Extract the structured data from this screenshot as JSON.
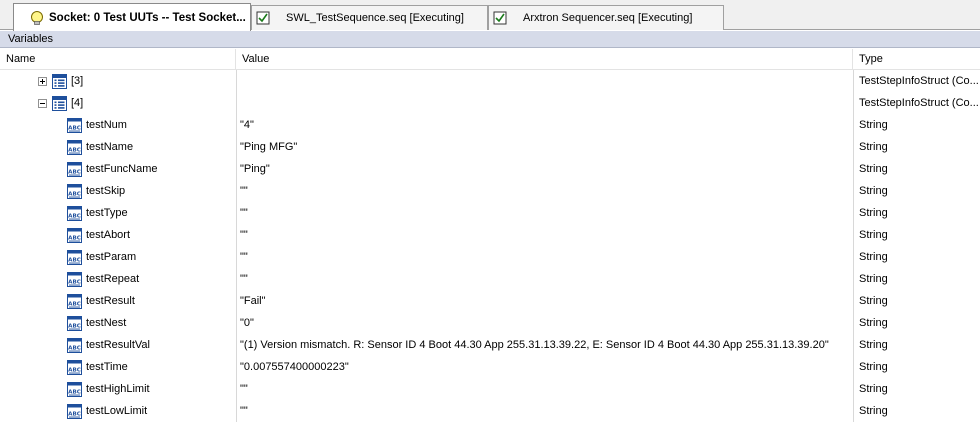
{
  "tabs": [
    {
      "label": "Socket: 0  Test UUTs -- Test Socket...",
      "active": true,
      "icon": "bulb-icon"
    },
    {
      "label": "SWL_TestSequence.seq [Executing]",
      "active": false,
      "icon": "sequence-file-icon"
    },
    {
      "label": "Arxtron Sequencer.seq [Executing]",
      "active": false,
      "icon": "sequence-file-icon"
    }
  ],
  "panel_title": "Variables",
  "columns": {
    "name": "Name",
    "value": "Value",
    "type": "Type"
  },
  "rows": [
    {
      "name": "[3]",
      "value": "",
      "type": "TestStepInfoStruct (Co...",
      "kind": "struct",
      "expander": "plus"
    },
    {
      "name": "[4]",
      "value": "",
      "type": "TestStepInfoStruct (Co...",
      "kind": "struct",
      "expander": "minus"
    },
    {
      "name": "testNum",
      "value": "\"4\"",
      "type": "String",
      "kind": "string"
    },
    {
      "name": "testName",
      "value": "\"Ping MFG\"",
      "type": "String",
      "kind": "string"
    },
    {
      "name": "testFuncName",
      "value": "\"Ping\"",
      "type": "String",
      "kind": "string"
    },
    {
      "name": "testSkip",
      "value": "\"\"",
      "type": "String",
      "kind": "string"
    },
    {
      "name": "testType",
      "value": "\"\"",
      "type": "String",
      "kind": "string"
    },
    {
      "name": "testAbort",
      "value": "\"\"",
      "type": "String",
      "kind": "string"
    },
    {
      "name": "testParam",
      "value": "\"\"",
      "type": "String",
      "kind": "string"
    },
    {
      "name": "testRepeat",
      "value": "\"\"",
      "type": "String",
      "kind": "string"
    },
    {
      "name": "testResult",
      "value": "\"Fail\"",
      "type": "String",
      "kind": "string"
    },
    {
      "name": "testNest",
      "value": "\"0\"",
      "type": "String",
      "kind": "string"
    },
    {
      "name": "testResultVal",
      "value": "\"(1) Version mismatch. R: Sensor ID 4  Boot 44.30  App 255.31.13.39.22, E: Sensor ID 4  Boot 44.30  App 255.31.13.39.20\"",
      "type": "String",
      "kind": "string"
    },
    {
      "name": "testTime",
      "value": "\"0.007557400000223\"",
      "type": "String",
      "kind": "string"
    },
    {
      "name": "testHighLimit",
      "value": "\"\"",
      "type": "String",
      "kind": "string"
    },
    {
      "name": "testLowLimit",
      "value": "\"\"",
      "type": "String",
      "kind": "string"
    }
  ],
  "colors": {
    "variables_bar": "#d6dbe9",
    "icon_blue": "#1e4f9c"
  }
}
